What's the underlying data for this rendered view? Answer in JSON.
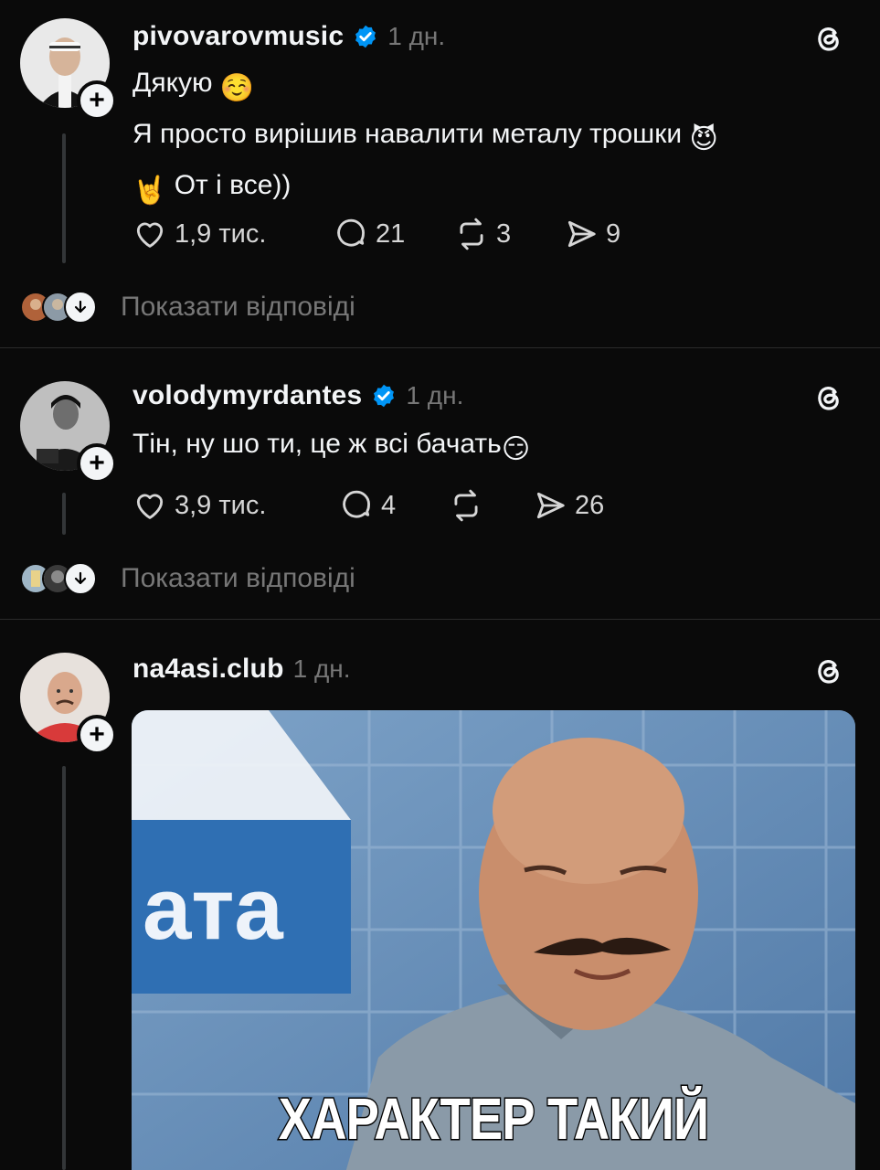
{
  "posts": [
    {
      "username": "pivovarovmusic",
      "verified": true,
      "time": "1 дн.",
      "lines": [
        "Дякую",
        "Я просто вирішив навалити металу трошки",
        "От і все))"
      ],
      "emojis": [
        "☺️",
        "😈",
        "🤘"
      ],
      "likes": "1,9 тис.",
      "comments": "21",
      "reposts": "3",
      "shares": "9",
      "show_replies": "Показати відповіді"
    },
    {
      "username": "volodymyrdantes",
      "verified": true,
      "time": "1 дн.",
      "lines": [
        "Тін, ну шо ти, це ж всі бачать"
      ],
      "emojis": [
        "😏"
      ],
      "likes": "3,9 тис.",
      "comments": "4",
      "reposts": "",
      "shares": "26",
      "show_replies": "Показати відповіді"
    },
    {
      "username": "na4asi.club",
      "verified": false,
      "time": "1 дн.",
      "image": {
        "caption": "ХАРАКТЕР ТАКИЙ",
        "background_text": "ата"
      }
    }
  ],
  "colors": {
    "background": "#0a0a0a",
    "text": "#f3f5f7",
    "muted": "#777777",
    "verified": "#0095f6"
  },
  "icons": [
    "heart-icon",
    "comment-icon",
    "repost-icon",
    "share-icon",
    "threads-logo-icon",
    "verified-icon",
    "follow-plus-icon",
    "chevron-down-icon"
  ]
}
